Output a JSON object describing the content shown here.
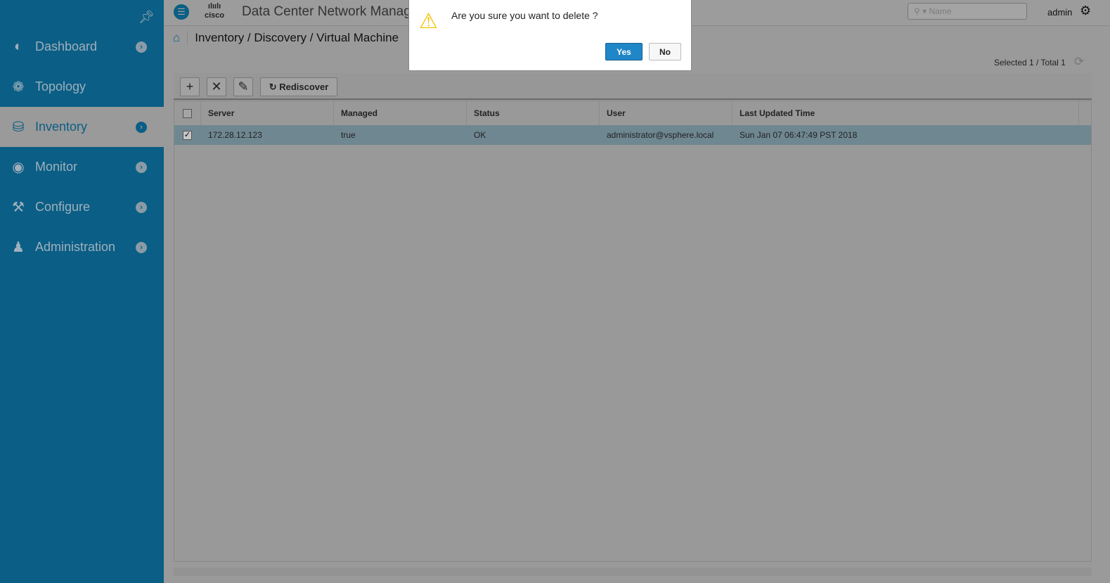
{
  "sidebar": {
    "items": [
      {
        "label": "Dashboard",
        "icon": "dashboard-icon",
        "chevron": true
      },
      {
        "label": "Topology",
        "icon": "topology-icon",
        "chevron": false
      },
      {
        "label": "Inventory",
        "icon": "database-icon",
        "chevron": true,
        "active": true
      },
      {
        "label": "Monitor",
        "icon": "eye-icon",
        "chevron": true
      },
      {
        "label": "Configure",
        "icon": "configure-icon",
        "chevron": true
      },
      {
        "label": "Administration",
        "icon": "admin-icon",
        "chevron": true
      }
    ]
  },
  "header": {
    "logo": "cisco",
    "app_title": "Data Center Network Manag",
    "search_placeholder": "Name",
    "user": "admin"
  },
  "breadcrumb": "Inventory / Discovery / Virtual Machine",
  "count": "Selected 1 / Total 1",
  "toolbar": {
    "rediscover": "Rediscover"
  },
  "table": {
    "columns": [
      "Server",
      "Managed",
      "Status",
      "User",
      "Last Updated Time"
    ],
    "rows": [
      [
        "172.28.12.123",
        "true",
        "OK",
        "administrator@vsphere.local",
        "Sun Jan 07 06:47:49 PST 2018"
      ]
    ]
  },
  "dialog": {
    "message": "Are you sure you want to delete ?",
    "yes": "Yes",
    "no": "No"
  },
  "colors": {
    "sidebar": "#0b5e85",
    "primary_button": "#1f86c8",
    "warning": "#f3c200"
  }
}
